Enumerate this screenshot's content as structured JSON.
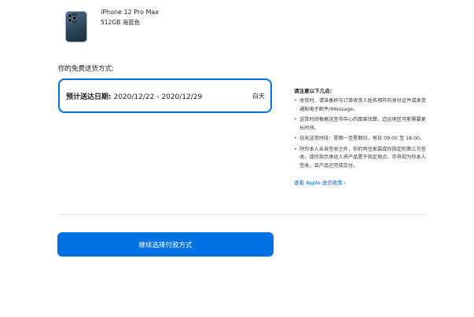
{
  "product": {
    "name": "iPhone 12 Pro Max",
    "spec": "512GB 海蓝色"
  },
  "delivery": {
    "heading": "你的免费送货方式:",
    "option": {
      "date_label": "预计送达日期:",
      "date_range": "2020/12/22 - 2020/12/29",
      "time_slot": "白天"
    }
  },
  "notes": {
    "title": "请注意以下几点:",
    "items": [
      "收货时，请准备好与订单收货人姓名相符的身份证件或发货通知电子邮件/iMessage。",
      "送货时间根据送至市中心的距离估算，边远地区可能需要更长时间。",
      "白天送货时段：星期一至星期日，每日 09:00 至 18:00。",
      "除你本人亲自签收之外，你的同住家属或你指定的第三方签收，或你指示承运人将产品置于指定地点，亦将视为你本人签收，且产品已完成交付。"
    ],
    "link": "查看 Apple 送货政策 ›"
  },
  "actions": {
    "continue_label": "继续选择付款方式"
  },
  "colors": {
    "accent": "#0071e3",
    "link": "#0066cc",
    "text": "#1d1d1f"
  }
}
